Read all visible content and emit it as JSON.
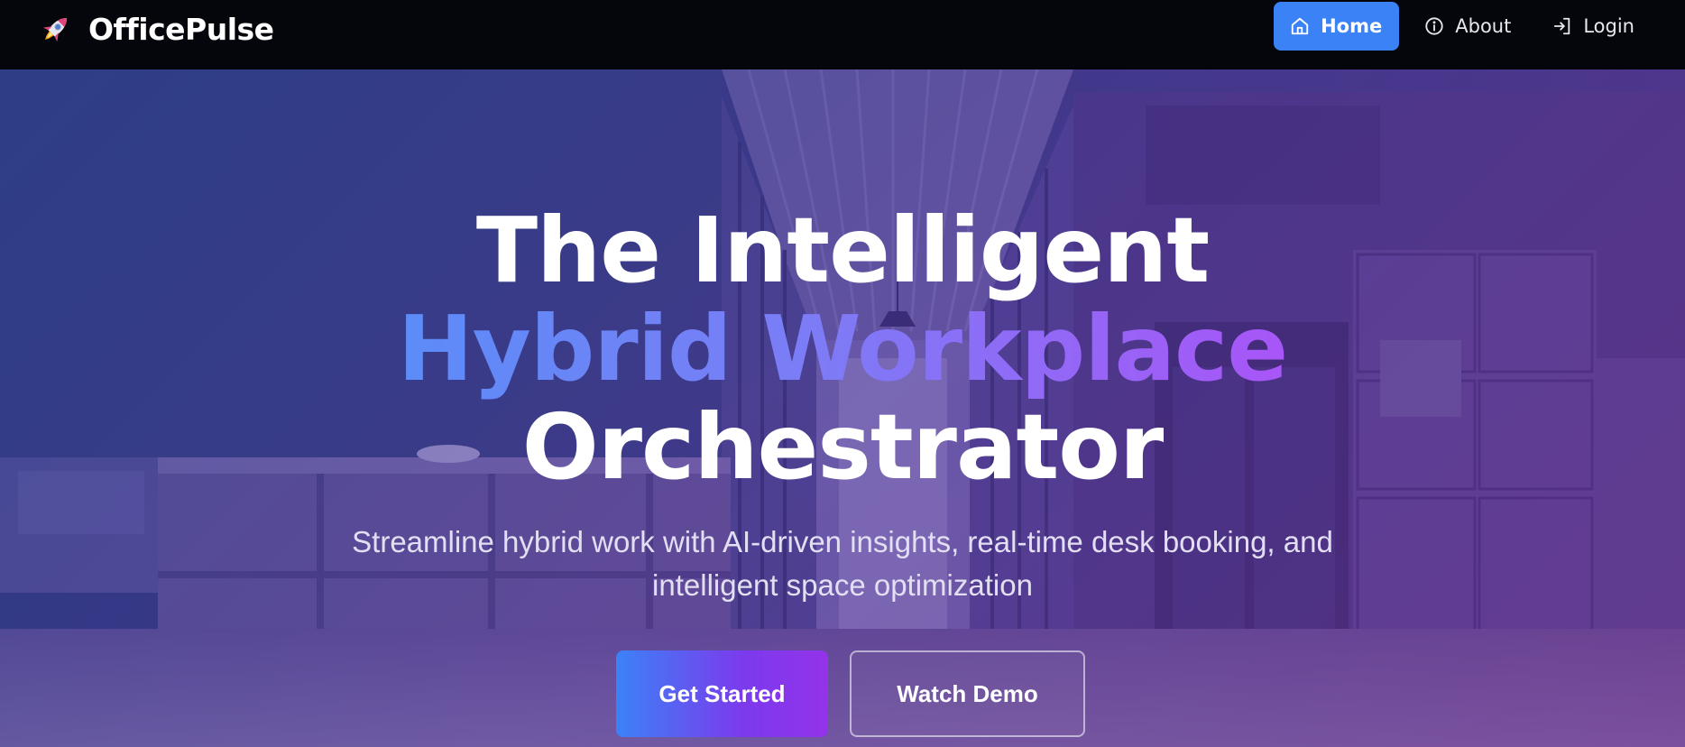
{
  "brand": {
    "name": "OfficePulse",
    "icon": "rocket-icon"
  },
  "nav": {
    "items": [
      {
        "label": "Home",
        "icon": "home-icon",
        "active": true
      },
      {
        "label": "About",
        "icon": "info-icon",
        "active": false
      },
      {
        "label": "Login",
        "icon": "login-icon",
        "active": false
      }
    ]
  },
  "hero": {
    "headline_line1": "The Intelligent",
    "headline_line2": "Hybrid Workplace",
    "headline_line3": "Orchestrator",
    "subtitle": "Streamline hybrid work with AI-driven insights, real-time desk booking, and intelligent space optimization",
    "primary_cta": "Get Started",
    "secondary_cta": "Watch Demo"
  },
  "colors": {
    "navbar_bg": "#05060b",
    "accent_blue": "#3b82f6",
    "gradient_purple": "#a855f7"
  }
}
